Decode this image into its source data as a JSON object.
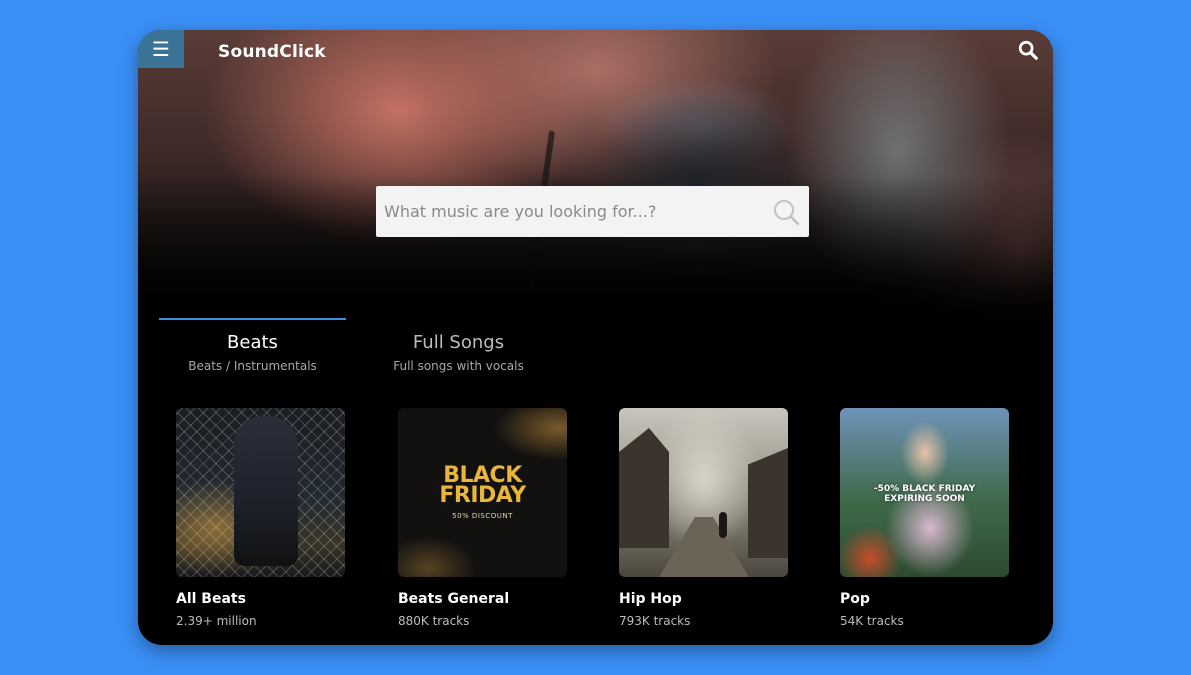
{
  "header": {
    "brand": "SoundClick",
    "menu_icon": "hamburger-menu-icon",
    "search_icon": "search-icon"
  },
  "hero": {
    "search_placeholder": "What music are you looking for...?"
  },
  "tabs": [
    {
      "title": "Beats",
      "subtitle": "Beats / Instrumentals",
      "active": true
    },
    {
      "title": "Full Songs",
      "subtitle": "Full songs with vocals",
      "active": false
    }
  ],
  "categories": [
    {
      "title": "All Beats",
      "count": "2.39+ million"
    },
    {
      "title": "Beats General",
      "count": "880K tracks",
      "art_text": [
        "BLACK",
        "FRIDAY"
      ],
      "art_subtext": "50% DISCOUNT"
    },
    {
      "title": "Hip Hop",
      "count": "793K tracks"
    },
    {
      "title": "Pop",
      "count": "54K tracks",
      "art_text": [
        "-50% BLACK FRIDAY",
        "EXPIRING SOON"
      ]
    }
  ],
  "colors": {
    "page_background": "#3a8ff5",
    "menu_button": "#3a7396",
    "active_tab_accent": "#3d8fd6"
  }
}
